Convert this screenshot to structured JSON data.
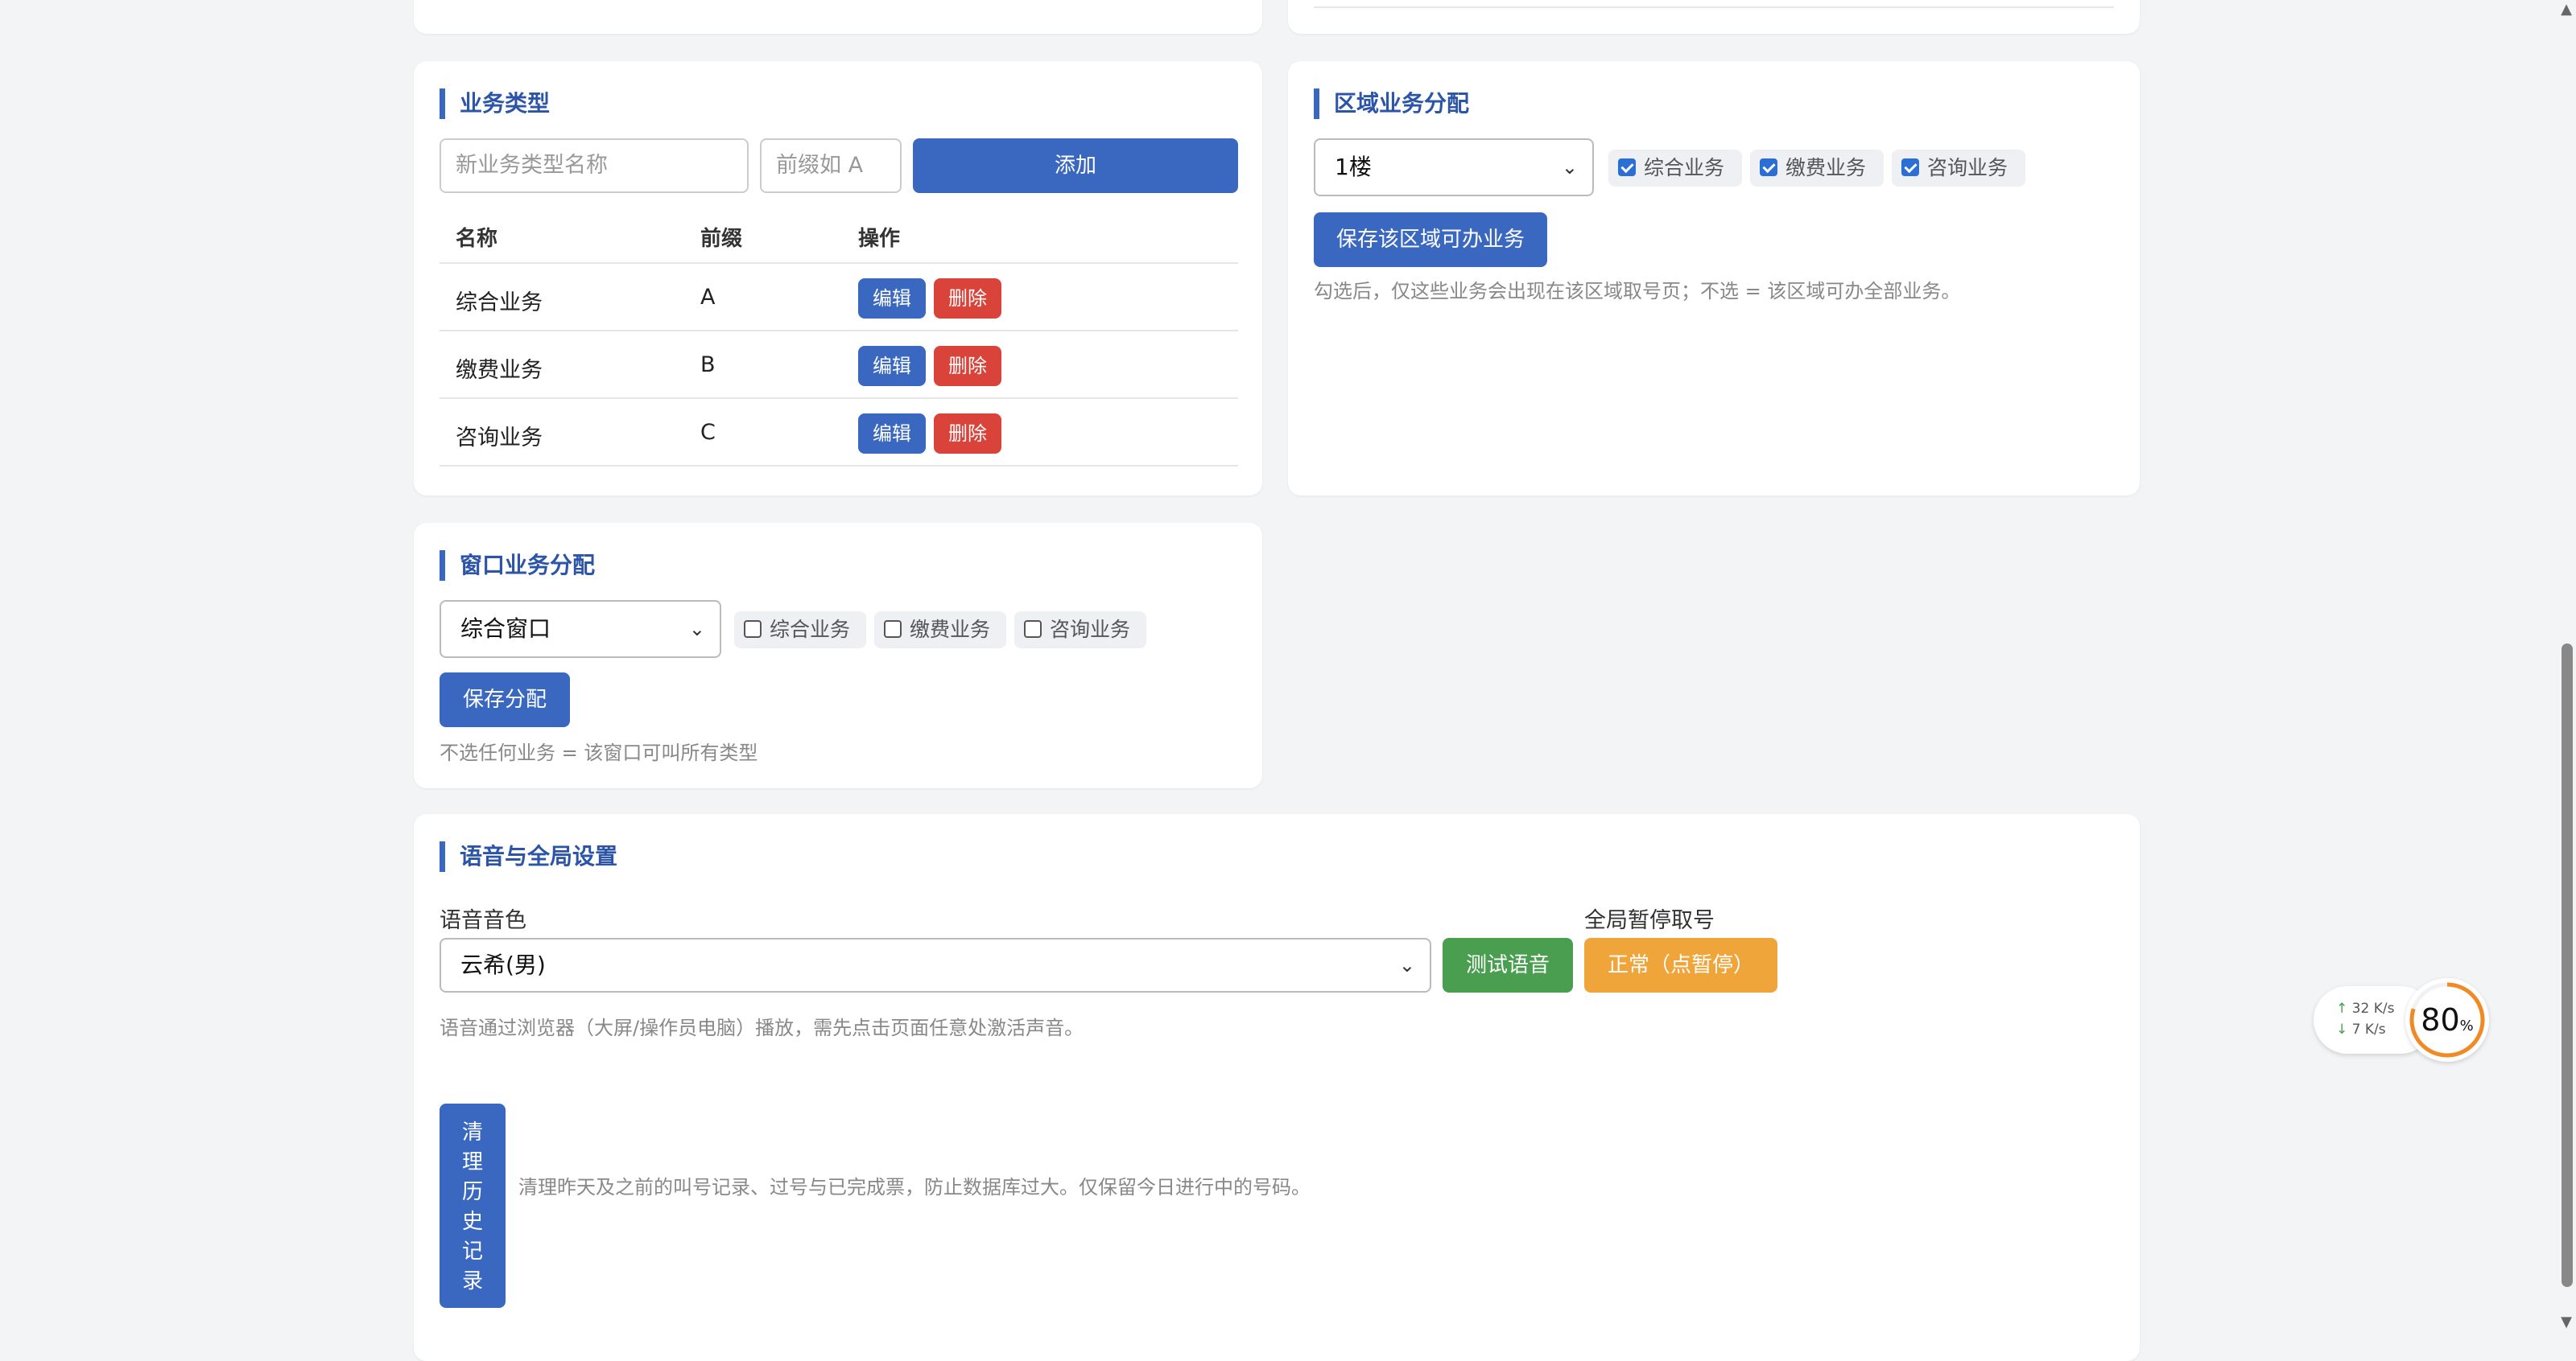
{
  "business_types": {
    "title": "业务类型",
    "name_placeholder": "新业务类型名称",
    "prefix_placeholder": "前缀如 A",
    "add_label": "添加",
    "columns": [
      "名称",
      "前缀",
      "操作"
    ],
    "rows": [
      {
        "name": "综合业务",
        "prefix": "A",
        "edit": "编辑",
        "delete": "删除"
      },
      {
        "name": "缴费业务",
        "prefix": "B",
        "edit": "编辑",
        "delete": "删除"
      },
      {
        "name": "咨询业务",
        "prefix": "C",
        "edit": "编辑",
        "delete": "删除"
      }
    ]
  },
  "area_assign": {
    "title": "区域业务分配",
    "selected_area": "1楼",
    "options": [
      {
        "label": "综合业务",
        "checked": true
      },
      {
        "label": "缴费业务",
        "checked": true
      },
      {
        "label": "咨询业务",
        "checked": true
      }
    ],
    "save_label": "保存该区域可办业务",
    "hint": "勾选后，仅这些业务会出现在该区域取号页；不选 = 该区域可办全部业务。"
  },
  "window_assign": {
    "title": "窗口业务分配",
    "selected_window": "综合窗口",
    "options": [
      {
        "label": "综合业务",
        "checked": false
      },
      {
        "label": "缴费业务",
        "checked": false
      },
      {
        "label": "咨询业务",
        "checked": false
      }
    ],
    "save_label": "保存分配",
    "hint": "不选任何业务 = 该窗口可叫所有类型"
  },
  "voice_settings": {
    "title": "语音与全局设置",
    "voice_label": "语音音色",
    "voice_value": "云希(男)",
    "test_label": "测试语音",
    "pause_label": "全局暂停取号",
    "pause_button": "正常（点暂停）",
    "voice_hint": "语音通过浏览器（大屏/操作员电脑）播放，需先点击页面任意处激活声音。",
    "clear_button_chars": [
      "清",
      "理",
      "历",
      "史",
      "记",
      "录"
    ],
    "clear_hint": "清理昨天及之前的叫号记录、过号与已完成票，防止数据库过大。仅保留今日进行中的号码。"
  },
  "net_widget": {
    "up": "32",
    "down": "7",
    "unit": "K/s",
    "percent": "80",
    "percent_sign": "%",
    "accent": "#f08a24"
  },
  "colors": {
    "primary": "#3a68c0",
    "danger": "#d9433a",
    "success": "#4a9e4f",
    "warning": "#f0a53a"
  }
}
